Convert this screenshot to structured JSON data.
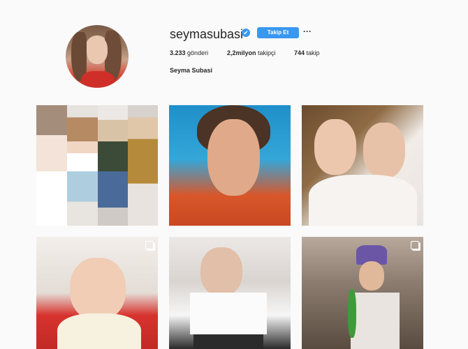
{
  "profile": {
    "username": "seymasubasi",
    "verified_glyph": "✔",
    "follow_label": "Takip Et",
    "more_glyph": "···",
    "full_name": "Seyma Subasi"
  },
  "stats": {
    "posts_count": "3.233",
    "posts_label": "gönderi",
    "followers_count": "2,2milyon",
    "followers_label": "takipçi",
    "following_count": "744",
    "following_label": "takip"
  },
  "posts": [
    {
      "multi": false
    },
    {
      "multi": false
    },
    {
      "multi": false
    },
    {
      "multi": true
    },
    {
      "multi": false
    },
    {
      "multi": true
    }
  ],
  "colors": {
    "accent": "#3897f0",
    "background": "#fafafa",
    "text": "#262626"
  },
  "icons": {
    "verified": "verified-badge-icon",
    "more": "more-options-icon",
    "multi": "multiple-photos-icon"
  }
}
